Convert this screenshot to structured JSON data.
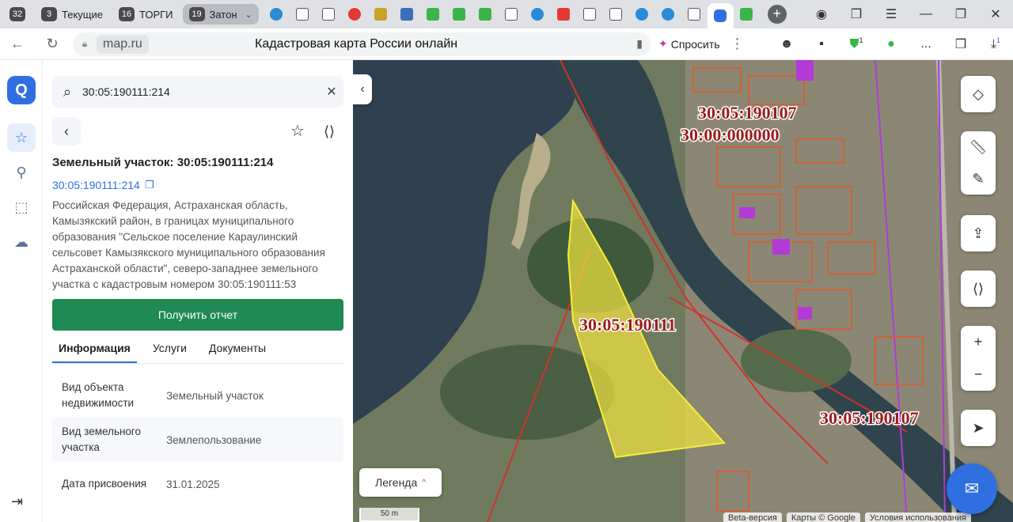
{
  "browser": {
    "tab_groups": [
      {
        "count": "32",
        "label": ""
      },
      {
        "count": "3",
        "label": "Текущие"
      },
      {
        "count": "16",
        "label": "ТОРГИ"
      },
      {
        "count": "19",
        "label": "Затон"
      }
    ],
    "address": {
      "domain": "map.ru",
      "title": "Кадастровая карта России онлайн",
      "ask_label": "Спросить",
      "more": "...",
      "downloads_badge": "1",
      "ext_badge": "1"
    }
  },
  "panel": {
    "search_value": "30:05:190111:214",
    "title": "Земельный участок: 30:05:190111:214",
    "cad_number": "30:05:190111:214",
    "address": "Российская Федерация, Астраханская область, Камызякский район, в границах муниципального образования \"Сельское поселение Караулинский сельсовет Камызякского муниципального образования Астраханской области\", северо-западнее земельного участка с кадастровым номером 30:05:190111:53",
    "report_button": "Получить отчет",
    "tabs": [
      "Информация",
      "Услуги",
      "Документы"
    ],
    "properties": [
      {
        "key": "Вид объекта недвижимости",
        "value": "Земельный участок"
      },
      {
        "key": "Вид земельного участка",
        "value": "Землепользование"
      },
      {
        "key": "Дата присвоения",
        "value": "31.01.2025"
      }
    ]
  },
  "map": {
    "labels": {
      "quarter_top_1": "30:05:190107",
      "quarter_top_2": "30:00:000000",
      "quarter_center": "30:05:190111",
      "quarter_right": "30:05:190107"
    },
    "legend_label": "Легенда",
    "scale_label": "50 m",
    "attribution": [
      "Beta-версия",
      "Карты © Google",
      "Условия использования"
    ]
  }
}
